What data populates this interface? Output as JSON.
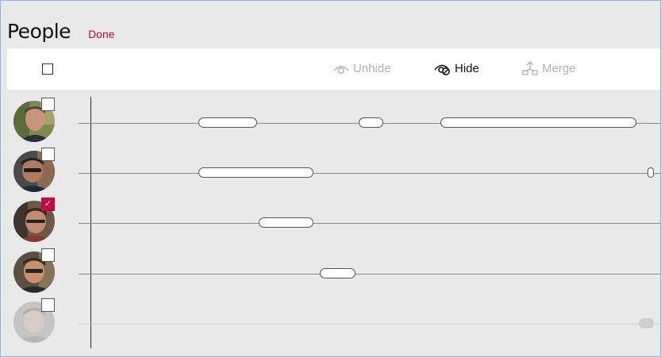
{
  "header": {
    "title": "People",
    "done_label": "Done"
  },
  "toolbar": {
    "unhide_label": "Unhide",
    "hide_label": "Hide",
    "merge_label": "Merge",
    "unhide_icon": "eye-icon",
    "hide_icon": "eye-hide-icon",
    "merge_icon": "merge-icon",
    "unhide_enabled": false,
    "hide_enabled": true,
    "merge_enabled": false
  },
  "colors": {
    "accent": "#c3093f",
    "background": "#e9e9e9",
    "toolbar_bg": "#ffffff",
    "disabled_text": "#b3b3b3"
  },
  "people": [
    {
      "checked": false,
      "faded": false
    },
    {
      "checked": true,
      "faded": false,
      "row_index": 2
    },
    {
      "checked": false,
      "faded": false
    },
    {
      "checked": false,
      "faded": false
    },
    {
      "checked": false,
      "faded": true
    }
  ]
}
